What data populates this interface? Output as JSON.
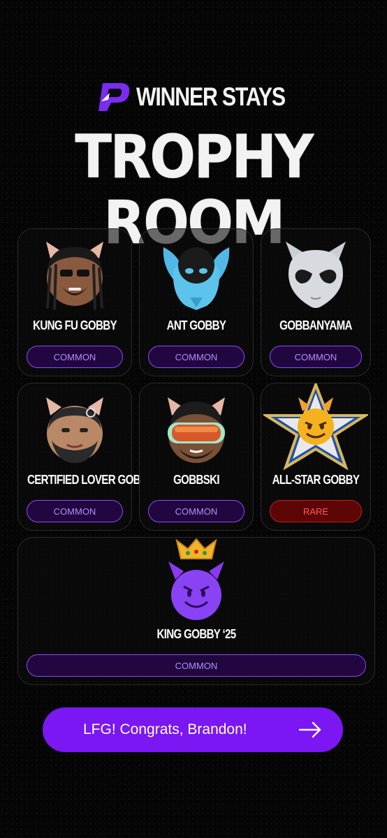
{
  "header": {
    "brand": "WINNER STAYS",
    "title": "TROPHY ROOM"
  },
  "trophies": [
    {
      "name": "KUNG FU GOBBY",
      "rarity": "COMMON",
      "icon": "kung-fu-gobby-avatar"
    },
    {
      "name": "ANT GOBBY",
      "rarity": "COMMON",
      "icon": "ant-gobby-avatar"
    },
    {
      "name": "GOBBANYAMA",
      "rarity": "COMMON",
      "icon": "gobbanyama-alien-avatar"
    },
    {
      "name": "CERTIFIED LOVER GOB",
      "rarity": "COMMON",
      "icon": "certified-lover-gob-avatar"
    },
    {
      "name": "GOBBSKI",
      "rarity": "COMMON",
      "icon": "gobbski-goggles-avatar"
    },
    {
      "name": "ALL-STAR GOBBY",
      "rarity": "RARE",
      "icon": "all-star-gobby-avatar"
    },
    {
      "name": "KING GOBBY ‘25",
      "rarity": "COMMON",
      "icon": "king-gobby-crown-avatar"
    }
  ],
  "cta": {
    "label": "LFG! Congrats, Brandon!",
    "icon": "arrow-right-icon"
  },
  "colors": {
    "accent": "#7a17f2",
    "common_badge_bg": "#22063f",
    "common_badge_border": "#8a4cff",
    "rare_badge_bg": "#5e0505",
    "rare_badge_border": "#c22020"
  }
}
